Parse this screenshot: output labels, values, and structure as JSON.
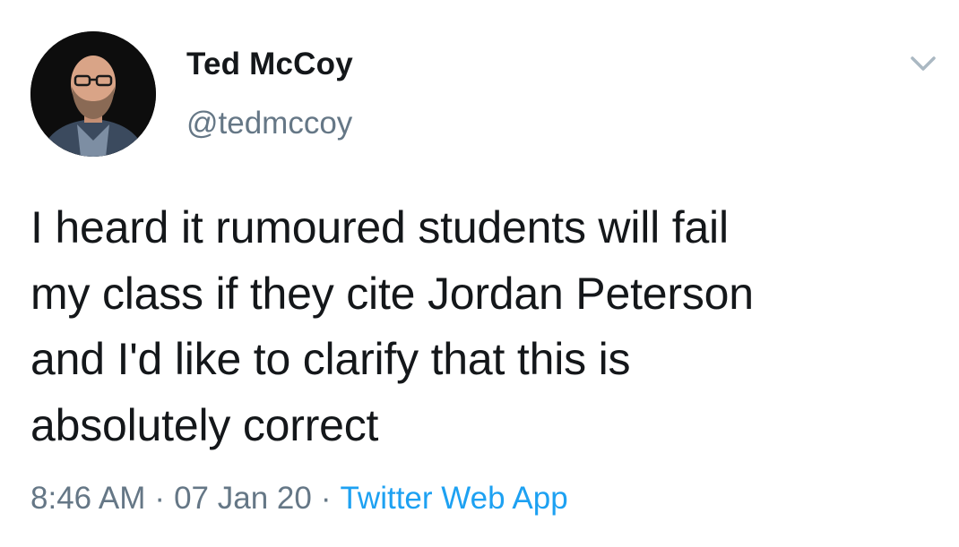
{
  "tweet": {
    "author": {
      "name": "Ted McCoy",
      "handle": "@tedmccoy",
      "avatar": "profile-photo"
    },
    "text": "I heard it rumoured students will fail\nmy class if they cite Jordan Peterson\nand I'd like to clarify that this is\nabsolutely correct",
    "time": "8:46 AM",
    "date": "07 Jan 20",
    "separator": "·",
    "source": "Twitter Web App"
  },
  "icons": {
    "more": "chevron-down-icon"
  },
  "colors": {
    "text": "#14171a",
    "secondary": "#657786",
    "link": "#1da1f2",
    "background": "#ffffff"
  }
}
